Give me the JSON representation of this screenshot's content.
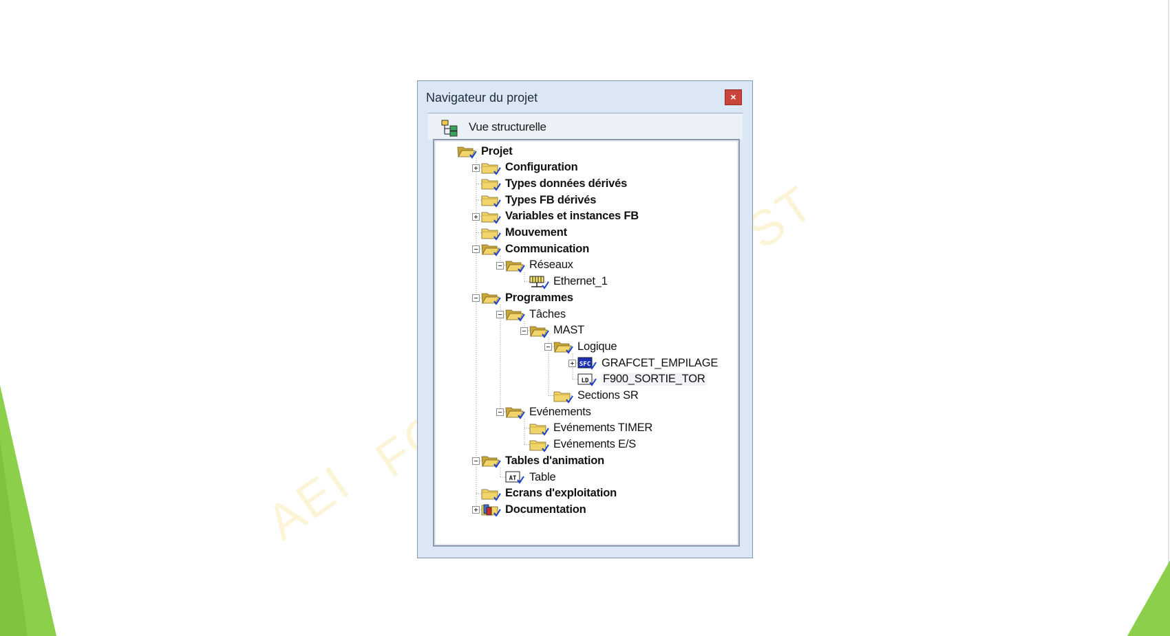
{
  "window": {
    "title": "Navigateur du projet",
    "close_label": "×"
  },
  "view": {
    "label": "Vue structurelle"
  },
  "watermark": [
    "AEI",
    "FO",
    "ST"
  ],
  "tree": [
    {
      "id": "projet",
      "label": "Projet",
      "bold": true,
      "icon": "folder-open-icon"
    },
    {
      "id": "configuration",
      "label": "Configuration",
      "bold": true,
      "icon": "folder-icon",
      "toggle": "collapsed"
    },
    {
      "id": "types-donnees",
      "label": "Types données dérivés",
      "bold": true,
      "icon": "folder-icon"
    },
    {
      "id": "types-fb",
      "label": "Types FB dérivés",
      "bold": true,
      "icon": "folder-icon"
    },
    {
      "id": "variables",
      "label": "Variables et instances FB",
      "bold": true,
      "icon": "folder-icon",
      "toggle": "collapsed"
    },
    {
      "id": "mouvement",
      "label": "Mouvement",
      "bold": true,
      "icon": "folder-icon"
    },
    {
      "id": "communication",
      "label": "Communication",
      "bold": true,
      "icon": "folder-open-icon",
      "toggle": "expanded"
    },
    {
      "id": "reseaux",
      "label": "Réseaux",
      "bold": false,
      "icon": "folder-open-icon",
      "toggle": "expanded"
    },
    {
      "id": "ethernet",
      "label": "Ethernet_1",
      "bold": false,
      "icon": "network-icon"
    },
    {
      "id": "programmes",
      "label": "Programmes",
      "bold": true,
      "icon": "folder-open-icon",
      "toggle": "expanded"
    },
    {
      "id": "taches",
      "label": "Tâches",
      "bold": false,
      "icon": "folder-open-icon",
      "toggle": "expanded"
    },
    {
      "id": "mast",
      "label": "MAST",
      "bold": false,
      "icon": "folder-open-icon",
      "toggle": "expanded"
    },
    {
      "id": "logique",
      "label": "Logique",
      "bold": false,
      "icon": "folder-open-icon",
      "toggle": "expanded"
    },
    {
      "id": "grafcet",
      "label": "GRAFCET_EMPILAGE",
      "bold": false,
      "icon": "sfc-section-icon",
      "icon_text": "SFC",
      "toggle": "collapsed"
    },
    {
      "id": "f900",
      "label": "F900_SORTIE_TOR",
      "bold": false,
      "icon": "ld-section-icon",
      "icon_text": "LD",
      "selected": true
    },
    {
      "id": "sections-sr",
      "label": "Sections SR",
      "bold": false,
      "icon": "folder-icon"
    },
    {
      "id": "evenements",
      "label": "Evénements",
      "bold": false,
      "icon": "folder-open-icon",
      "toggle": "expanded"
    },
    {
      "id": "evt-timer",
      "label": "Evénements TIMER",
      "bold": false,
      "icon": "folder-icon"
    },
    {
      "id": "evt-es",
      "label": "Evénements E/S",
      "bold": false,
      "icon": "folder-icon"
    },
    {
      "id": "tables-animation",
      "label": "Tables d'animation",
      "bold": true,
      "icon": "folder-open-icon",
      "toggle": "expanded"
    },
    {
      "id": "table",
      "label": "Table",
      "bold": false,
      "icon": "animation-table-icon",
      "icon_text": "AT"
    },
    {
      "id": "ecrans",
      "label": "Ecrans d'exploitation",
      "bold": true,
      "icon": "folder-icon"
    },
    {
      "id": "documentation",
      "label": "Documentation",
      "bold": true,
      "icon": "documentation-icon",
      "toggle": "collapsed"
    }
  ],
  "colors": {
    "folder": "#f1d46a",
    "folder_dark": "#c9a63a",
    "check": "#1a3fc9",
    "tree_line": "#8c8c8c",
    "deco_green": "#8ccf4a"
  }
}
